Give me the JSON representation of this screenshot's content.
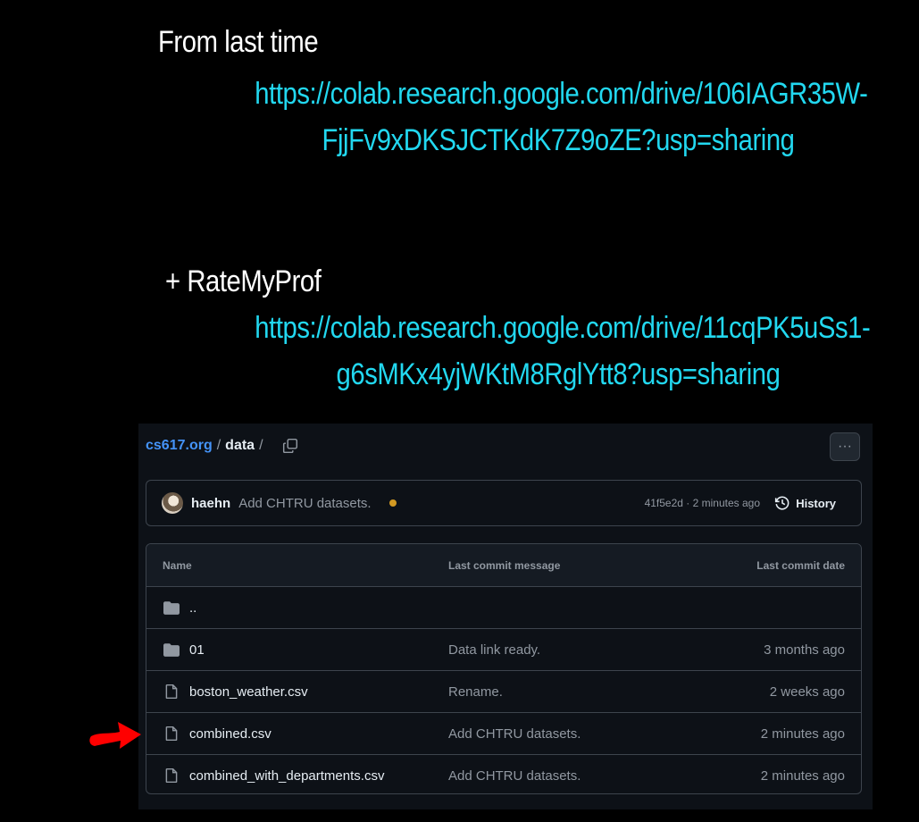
{
  "slide": {
    "heading1": "From last time",
    "link1_line1": "https://colab.research.google.com/drive/106IAGR35W-",
    "link1_line2": "FjjFv9xDKSJCTKdK7Z9oZE?usp=sharing",
    "heading2": "+ RateMyProf",
    "link2_line1": "https://colab.research.google.com/drive/11cqPK5uSs1-",
    "link2_line2": "g6sMKx4yjWKtM8RglYtt8?usp=sharing"
  },
  "github": {
    "breadcrumb": {
      "repo": "cs617.org",
      "sep1": "/",
      "folder": "data",
      "sep2": "/"
    },
    "more_label": "···",
    "commit": {
      "user": "haehn",
      "message": "Add CHTRU datasets.",
      "meta": "41f5e2d · 2 minutes ago",
      "history_label": "History"
    },
    "table": {
      "headers": {
        "name": "Name",
        "message": "Last commit message",
        "date": "Last commit date"
      },
      "rows": [
        {
          "name": "..",
          "type": "folder",
          "message": "",
          "date": ""
        },
        {
          "name": "01",
          "type": "folder",
          "message": "Data link ready.",
          "date": "3 months ago"
        },
        {
          "name": "boston_weather.csv",
          "type": "file",
          "message": "Rename.",
          "date": "2 weeks ago"
        },
        {
          "name": "combined.csv",
          "type": "file",
          "message": "Add CHTRU datasets.",
          "date": "2 minutes ago"
        },
        {
          "name": "combined_with_departments.csv",
          "type": "file",
          "message": "Add CHTRU datasets.",
          "date": "2 minutes ago"
        }
      ]
    }
  },
  "colors": {
    "link": "#22d8f0",
    "arrow": "#ff0000",
    "status_dot": "#d29922",
    "repo_link": "#4493f8"
  },
  "annotations": {
    "arrow_icon": "red-hand-drawn-arrow-icon"
  }
}
